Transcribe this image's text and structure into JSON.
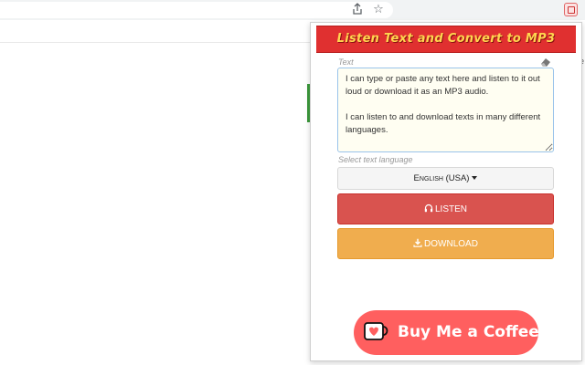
{
  "browser": {
    "share_icon": "share-icon",
    "star_icon": "star-icon",
    "extension_icon": "extension-icon"
  },
  "popup": {
    "banner_title": "Listen Text and Convert to MP3",
    "text_label": "Text",
    "text_value": "I can type or paste any text here and listen to it out loud or download it as an MP3 audio.\n\nI can listen to and download texts in many different languages.",
    "eraser_icon": "eraser-icon",
    "language_label": "Select text language",
    "language_selected": "English (USA)",
    "listen_icon": "headphones-icon",
    "listen_label": "LISTEN",
    "download_icon": "download-icon",
    "download_label": "DOWNLOAD",
    "coffee_label": "Buy Me a Coffee",
    "coffee_icon": "coffee-cup-heart-icon"
  },
  "background": {
    "edge_text": "e"
  },
  "colors": {
    "banner_red": "#e03030",
    "banner_text": "#ffd54f",
    "listen_red": "#d9534f",
    "download_orange": "#f0ad4e",
    "coffee_pink": "#ff5f5f",
    "textarea_bg": "#fffef2"
  }
}
